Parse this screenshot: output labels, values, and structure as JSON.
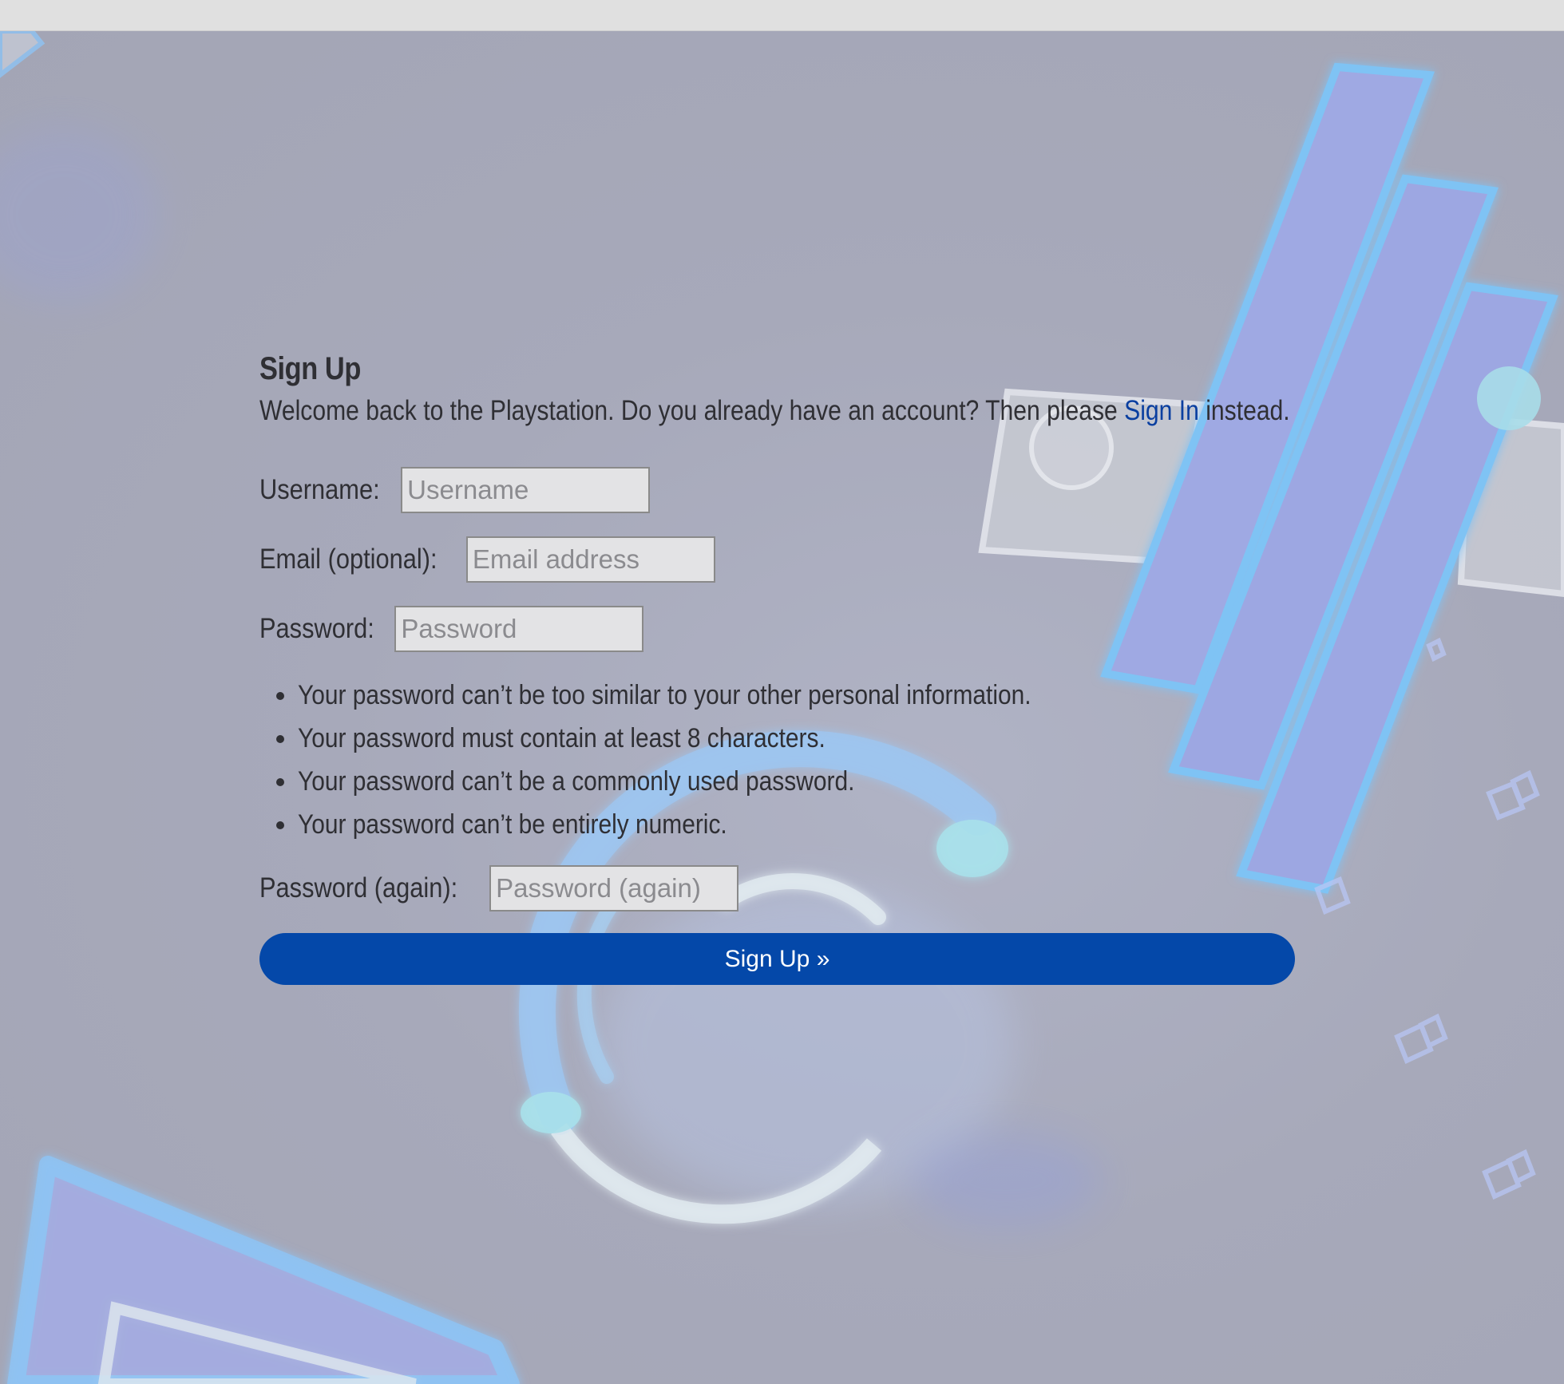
{
  "page": {
    "title": "Sign Up",
    "intro_before": "Welcome back to the Playstation. Do you already have an account? Then please ",
    "intro_link": "Sign In",
    "intro_after": " instead."
  },
  "form": {
    "username": {
      "label": "Username:",
      "placeholder": "Username",
      "value": ""
    },
    "email": {
      "label": "Email (optional):",
      "placeholder": "Email address",
      "value": ""
    },
    "password": {
      "label": "Password:",
      "placeholder": "Password",
      "value": ""
    },
    "password_rules": [
      "Your password can’t be too similar to your other personal information.",
      "Your password must contain at least 8 characters.",
      "Your password can’t be a commonly used password.",
      "Your password can’t be entirely numeric."
    ],
    "password_again": {
      "label": "Password (again):",
      "placeholder": "Password (again)",
      "value": ""
    },
    "submit_label": "Sign Up »"
  },
  "colors": {
    "link": "#0a3fa0",
    "button": "#0448a9",
    "background": "#a6a8b8"
  }
}
